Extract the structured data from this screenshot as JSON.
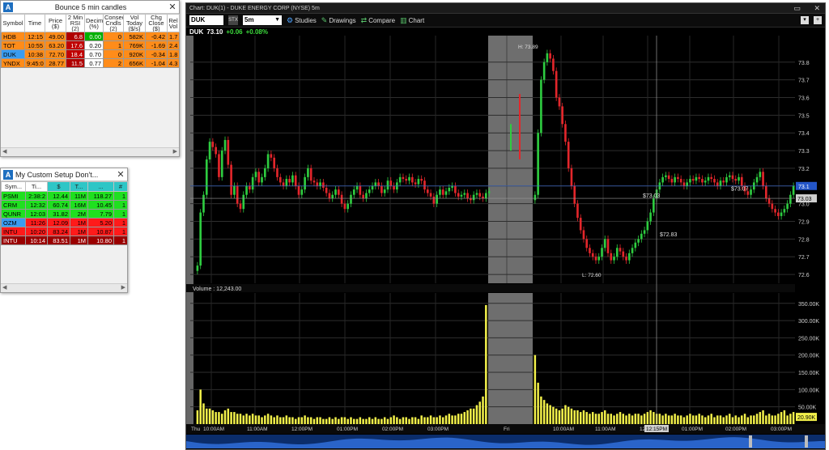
{
  "bounce_window": {
    "title": "Bounce 5 min candles",
    "app_icon": "A",
    "headers": [
      "Symbol",
      "Time",
      "Price ($)",
      "2 Min RSI (2)",
      "Decimal (%)",
      "Consec Cndls (2)",
      "Vol Today ($/s)",
      "Chg Close ($)",
      "Rel Vol"
    ],
    "rows": [
      {
        "cells": [
          "HDB",
          "12:15",
          "49.00",
          "6.8",
          "0.00",
          "0",
          "582K",
          "-0.42",
          "1.7"
        ],
        "colors": [
          "#ff8c1a",
          "#ff8c1a",
          "#ff8c1a",
          "#b00000",
          "#00b000",
          "#ff8c1a",
          "#ff8c1a",
          "#ff8c1a",
          "#ff8c1a"
        ]
      },
      {
        "cells": [
          "TOT",
          "10:55",
          "63.20",
          "17.6",
          "0.20",
          "1",
          "769K",
          "-1.69",
          "2.4"
        ],
        "colors": [
          "#ff8c1a",
          "#ff8c1a",
          "#ff8c1a",
          "#c00000",
          "#ffffff",
          "#ff8c1a",
          "#ff8c1a",
          "#ff8c1a",
          "#ff8c1a"
        ]
      },
      {
        "cells": [
          "DUK",
          "10:38",
          "72.70",
          "18.4",
          "0.70",
          "0",
          "920K",
          "-0.34",
          "1.8"
        ],
        "colors": [
          "#3a9cf0",
          "#ff8c1a",
          "#ff8c1a",
          "#c00000",
          "#ffffff",
          "#ff8c1a",
          "#ff8c1a",
          "#ff8c1a",
          "#ff8c1a"
        ]
      },
      {
        "cells": [
          "YNDX",
          "9:45:0",
          "28.77",
          "11.5",
          "0.77",
          "2",
          "656K",
          "-1.04",
          "4.3"
        ],
        "colors": [
          "#ff8c1a",
          "#ff8c1a",
          "#ff8c1a",
          "#b00000",
          "#ffffff",
          "#ff8c1a",
          "#ff8c1a",
          "#ff8c1a",
          "#ff8c1a"
        ]
      }
    ]
  },
  "custom_window": {
    "title": "My Custom Setup Don't...",
    "app_icon": "A",
    "headers": [
      "Sym...",
      "Ti...",
      "$",
      "T...",
      "...",
      "#"
    ],
    "rows": [
      {
        "cells": [
          "PSMI",
          "2:38:2",
          "12.44",
          "11M",
          "118.27",
          "1"
        ],
        "bg": "#1fe01f",
        "fg": "#000000"
      },
      {
        "cells": [
          "CRM",
          "12:32",
          "60.74",
          "16M",
          "10.45",
          "1"
        ],
        "bg": "#1fe01f",
        "fg": "#000000"
      },
      {
        "cells": [
          "QUNR",
          "12:03",
          "31.82",
          "2M",
          "7.79",
          "1"
        ],
        "bg": "#1fe01f",
        "fg": "#000000"
      },
      {
        "cells": [
          "OZM",
          "11:26",
          "12.09",
          "1M",
          "5.20",
          "1"
        ],
        "bg": "#ff1a1a",
        "fg": "#000000",
        "first_bg": "#3a9cf0"
      },
      {
        "cells": [
          "INTU",
          "10:20",
          "83.24",
          "1M",
          "10.87",
          "1"
        ],
        "bg": "#ff1a1a",
        "fg": "#000000"
      },
      {
        "cells": [
          "INTU",
          "10:14",
          "83.51",
          "1M",
          "10.80",
          "1"
        ],
        "bg": "#9a0000",
        "fg": "#ffffff"
      }
    ]
  },
  "chart_window": {
    "title": "Chart: DUK(1) - DUKE ENERGY CORP (NYSE) 5m",
    "symbol": "DUK",
    "stx_label": "STX",
    "interval": "5m",
    "toolbar": {
      "studies": "Studies",
      "drawings": "Drawings",
      "compare": "Compare",
      "chart": "Chart"
    },
    "quote": {
      "symbol": "DUK",
      "last": "73.10",
      "change": "+0.06",
      "pct": "+0.08%"
    },
    "volume_label": "Volume : 12,243.00",
    "price_badge": "73.03",
    "last_badge": "73.1",
    "annotations": {
      "high": "H: 73.89",
      "low": "L: 72.60",
      "a1": "$73.03",
      "a2": "$73.07",
      "a3": "$72.83"
    },
    "volume_badge": "20.90K",
    "time_badge": "12:15PM"
  },
  "chart_data": {
    "type": "candlestick",
    "title": "",
    "price_ticks": [
      73.8,
      73.7,
      73.6,
      73.5,
      73.4,
      73.3,
      73.2,
      73.1,
      73.0,
      72.9,
      72.8,
      72.7,
      72.6
    ],
    "price_range": [
      72.55,
      73.95
    ],
    "volume_ticks": [
      "350.00K",
      "300.00K",
      "250.00K",
      "200.00K",
      "150.00K",
      "100.00K",
      "50.00K"
    ],
    "volume_range": [
      0,
      380000
    ],
    "x_labels": [
      "Thu",
      "10:00AM",
      "11:00AM",
      "12:00PM",
      "01:00PM",
      "02:00PM",
      "03:00PM",
      "Fri",
      "10:00AM",
      "11:00AM",
      "12:00PM",
      "01:00PM",
      "02:00PM",
      "03:00PM"
    ],
    "day1": {
      "closes": [
        72.65,
        72.95,
        73.05,
        73.25,
        73.35,
        73.32,
        73.28,
        73.15,
        73.3,
        73.36,
        73.22,
        73.05,
        73.1,
        73.0,
        72.97,
        73.05,
        73.1,
        73.08,
        73.15,
        73.18,
        73.12,
        73.15,
        73.2,
        73.28,
        73.26,
        73.2,
        73.15,
        73.12,
        73.1,
        73.14,
        73.12,
        73.16,
        73.1,
        73.05,
        73.08,
        73.15,
        73.2,
        73.13,
        73.12,
        73.1,
        73.12,
        73.09,
        73.06,
        73.03,
        73.05,
        73.08,
        73.05,
        73.0,
        72.97,
        73.0,
        73.05,
        73.08,
        73.1,
        73.05,
        73.03,
        73.06,
        73.08,
        73.1,
        73.12,
        73.1,
        73.06,
        73.08,
        73.13,
        73.1,
        73.08,
        73.12,
        73.15,
        73.14,
        73.13,
        73.15,
        73.12,
        73.11,
        73.14,
        73.13,
        73.08,
        73.06,
        73.04,
        73.0,
        73.05,
        73.08,
        73.05,
        73.07,
        73.09,
        73.1,
        73.06,
        73.04,
        73.05,
        73.06,
        73.03,
        73.02,
        73.05,
        73.06,
        73.04,
        73.03,
        73.06,
        73.07
      ],
      "volumes": [
        40000,
        100000,
        60000,
        45000,
        45000,
        40000,
        35000,
        35000,
        30000,
        40000,
        45000,
        35000,
        35000,
        30000,
        30000,
        25000,
        30000,
        25000,
        30000,
        25000,
        25000,
        20000,
        25000,
        30000,
        25000,
        20000,
        25000,
        20000,
        20000,
        25000,
        20000,
        20000,
        15000,
        20000,
        20000,
        25000,
        20000,
        20000,
        15000,
        20000,
        20000,
        15000,
        15000,
        20000,
        15000,
        20000,
        15000,
        20000,
        20000,
        15000,
        20000,
        15000,
        15000,
        20000,
        15000,
        15000,
        20000,
        15000,
        20000,
        15000,
        15000,
        20000,
        15000,
        20000,
        25000,
        20000,
        15000,
        20000,
        20000,
        15000,
        20000,
        20000,
        15000,
        25000,
        20000,
        20000,
        25000,
        20000,
        20000,
        25000,
        20000,
        25000,
        30000,
        25000,
        25000,
        30000,
        30000,
        35000,
        40000,
        45000,
        45000,
        55000,
        65000,
        80000,
        345000,
        0
      ]
    },
    "afterhours": {
      "green": [
        73.3,
        73.45
      ],
      "red": [
        73.62,
        73.25
      ]
    },
    "day2": {
      "closes": [
        73.05,
        73.4,
        73.7,
        73.8,
        73.85,
        73.82,
        73.75,
        73.6,
        73.55,
        73.45,
        73.35,
        73.2,
        73.1,
        73.0,
        72.92,
        72.85,
        72.8,
        72.75,
        72.72,
        72.7,
        72.68,
        72.7,
        72.75,
        72.8,
        72.72,
        72.68,
        72.7,
        72.75,
        72.73,
        72.7,
        72.68,
        72.72,
        72.75,
        72.78,
        72.8,
        72.83,
        72.85,
        72.9,
        72.95,
        73.03,
        73.08,
        73.12,
        73.15,
        73.16,
        73.14,
        73.12,
        73.15,
        73.14,
        73.12,
        73.1,
        73.12,
        73.14,
        73.13,
        73.15,
        73.14,
        73.12,
        73.13,
        73.15,
        73.14,
        73.12,
        73.1,
        73.13,
        73.12,
        73.15,
        73.16,
        73.14,
        73.13,
        73.15,
        73.1,
        73.07,
        73.05,
        73.08,
        73.12,
        73.15,
        73.18,
        73.1,
        73.03,
        73.0,
        72.97,
        72.95,
        72.93,
        72.95,
        72.97,
        73.0,
        73.05,
        73.1
      ],
      "volumes": [
        200000,
        120000,
        80000,
        70000,
        60000,
        55000,
        50000,
        45000,
        40000,
        45000,
        55000,
        50000,
        45000,
        40000,
        40000,
        35000,
        40000,
        35000,
        30000,
        35000,
        30000,
        30000,
        35000,
        40000,
        30000,
        30000,
        25000,
        30000,
        35000,
        30000,
        25000,
        30000,
        25000,
        30000,
        30000,
        25000,
        30000,
        35000,
        40000,
        35000,
        30000,
        30000,
        25000,
        30000,
        25000,
        25000,
        30000,
        25000,
        25000,
        20000,
        25000,
        30000,
        25000,
        25000,
        30000,
        25000,
        20000,
        25000,
        30000,
        20000,
        25000,
        25000,
        20000,
        25000,
        30000,
        20000,
        25000,
        20000,
        25000,
        30000,
        20000,
        25000,
        25000,
        30000,
        35000,
        40000,
        25000,
        30000,
        25000,
        25000,
        30000,
        35000,
        40000,
        25000,
        30000,
        35000
      ]
    }
  }
}
